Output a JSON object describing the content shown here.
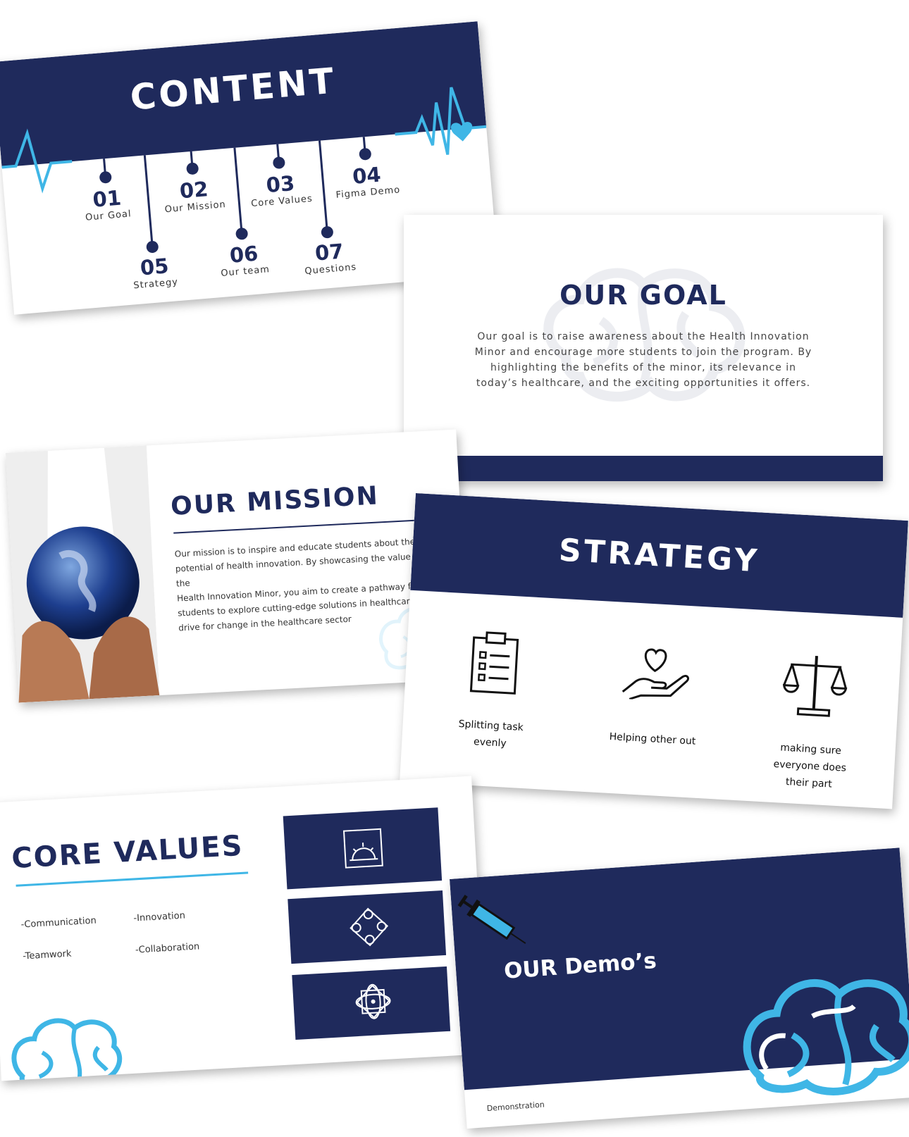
{
  "content_slide": {
    "title": "CONTENT",
    "items": [
      {
        "num": "01",
        "label": "Our Goal"
      },
      {
        "num": "02",
        "label": "Our Mission"
      },
      {
        "num": "03",
        "label": "Core Values"
      },
      {
        "num": "04",
        "label": "Figma Demo"
      },
      {
        "num": "05",
        "label": "Strategy"
      },
      {
        "num": "06",
        "label": "Our team"
      },
      {
        "num": "07",
        "label": "Questions"
      }
    ]
  },
  "goal_slide": {
    "title": "OUR GOAL",
    "lines": [
      "Our goal is to raise awareness about the Health Innovation",
      "Minor and encourage more students to join the program. By",
      "highlighting the benefits of the minor, its relevance in",
      "today’s healthcare, and the exciting opportunities it offers."
    ]
  },
  "mission_slide": {
    "title": "OUR MISSION",
    "lines": [
      "Our mission is to inspire and educate students about the",
      "potential of health innovation. By showcasing the value of the",
      "Health Innovation Minor, you aim to create a pathway for",
      "students to explore cutting-edge solutions in healthcare, and",
      "drive for change in the healthcare sector"
    ]
  },
  "strategy_slide": {
    "title": "STRATEGY",
    "items": [
      {
        "icon": "clipboard-list-icon",
        "lines": [
          "Splitting task",
          "evenly"
        ]
      },
      {
        "icon": "heart-hand-icon",
        "lines": [
          "Helping other out"
        ]
      },
      {
        "icon": "scales-icon",
        "lines": [
          "making sure",
          "everyone does",
          "their part"
        ]
      }
    ]
  },
  "core_values_slide": {
    "title": "CORE VALUES",
    "values": [
      "-Communication",
      "-Innovation",
      "-Teamwork",
      "-Collaboration"
    ],
    "icons": [
      "framed-sun-icon",
      "diamond-knot-icon",
      "atom-pattern-icon"
    ]
  },
  "demo_slide": {
    "title": "OUR Demo’s",
    "footer": "Demonstration"
  },
  "colors": {
    "navy": "#1f2a5c",
    "accent_blue": "#3fb6e6",
    "text_gray": "#333333"
  }
}
